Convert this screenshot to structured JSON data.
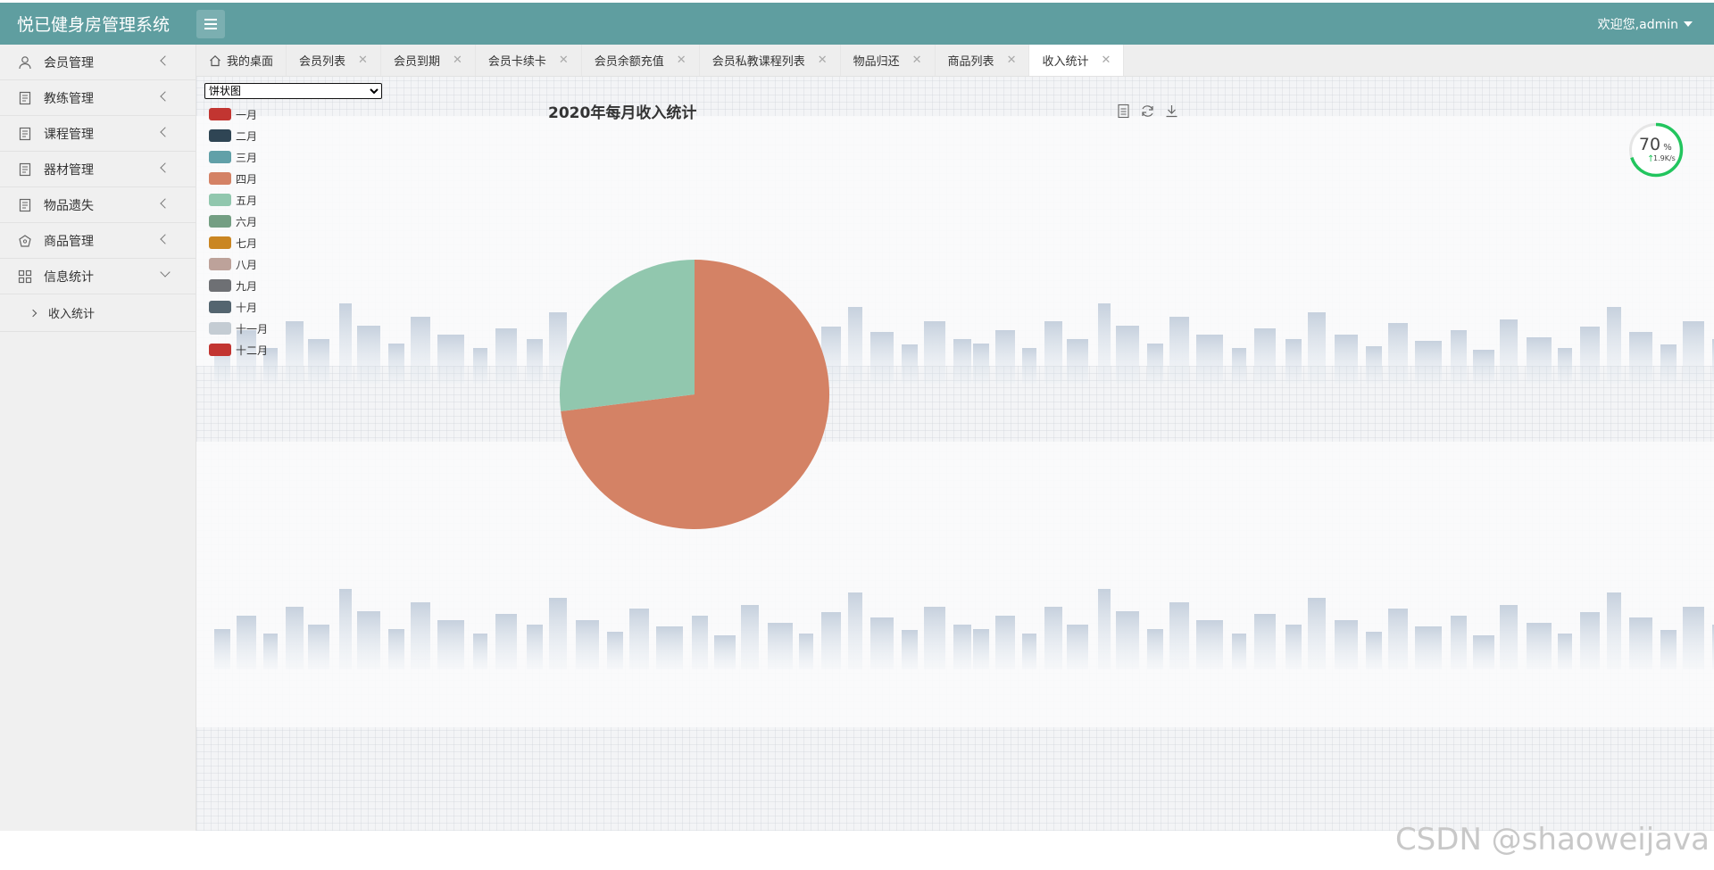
{
  "app": {
    "title": "悦已健身房管理系统",
    "welcome": "欢迎您,admin"
  },
  "sidebar": {
    "items": [
      {
        "label": "会员管理",
        "icon": "user-icon"
      },
      {
        "label": "教练管理",
        "icon": "document-icon"
      },
      {
        "label": "课程管理",
        "icon": "document-icon"
      },
      {
        "label": "器材管理",
        "icon": "document-icon"
      },
      {
        "label": "物品遗失",
        "icon": "document-icon"
      },
      {
        "label": "商品管理",
        "icon": "gift-icon"
      },
      {
        "label": "信息统计",
        "icon": "grid-icon"
      }
    ],
    "sub_items": [
      {
        "label": "收入统计"
      }
    ]
  },
  "tabs": [
    {
      "label": "我的桌面",
      "closable": false
    },
    {
      "label": "会员列表",
      "closable": true
    },
    {
      "label": "会员到期",
      "closable": true
    },
    {
      "label": "会员卡续卡",
      "closable": true
    },
    {
      "label": "会员余额充值",
      "closable": true
    },
    {
      "label": "会员私教课程列表",
      "closable": true
    },
    {
      "label": "物品归还",
      "closable": true
    },
    {
      "label": "商品列表",
      "closable": true
    },
    {
      "label": "收入统计",
      "closable": true,
      "active": true
    }
  ],
  "chart_select": {
    "selected": "饼状图"
  },
  "speed_widget": {
    "percent": "70",
    "unit": "%",
    "rate": "1.9K/s",
    "level": 0.7
  },
  "watermark": "CSDN @shaoweijava",
  "chart_data": {
    "type": "pie",
    "title": "2020年每月收入统计",
    "legend_position": "top-left",
    "categories": [
      "一月",
      "二月",
      "三月",
      "四月",
      "五月",
      "六月",
      "七月",
      "八月",
      "九月",
      "十月",
      "十一月",
      "十二月"
    ],
    "colors": [
      "#c23531",
      "#2f4554",
      "#61a0a8",
      "#d48265",
      "#91c7ae",
      "#749f83",
      "#ca8622",
      "#bda29a",
      "#6e7074",
      "#546570",
      "#c4ccd3",
      "#c23531"
    ],
    "values": [
      0,
      0,
      0,
      73,
      27,
      0,
      0,
      0,
      0,
      0,
      0,
      0
    ]
  }
}
